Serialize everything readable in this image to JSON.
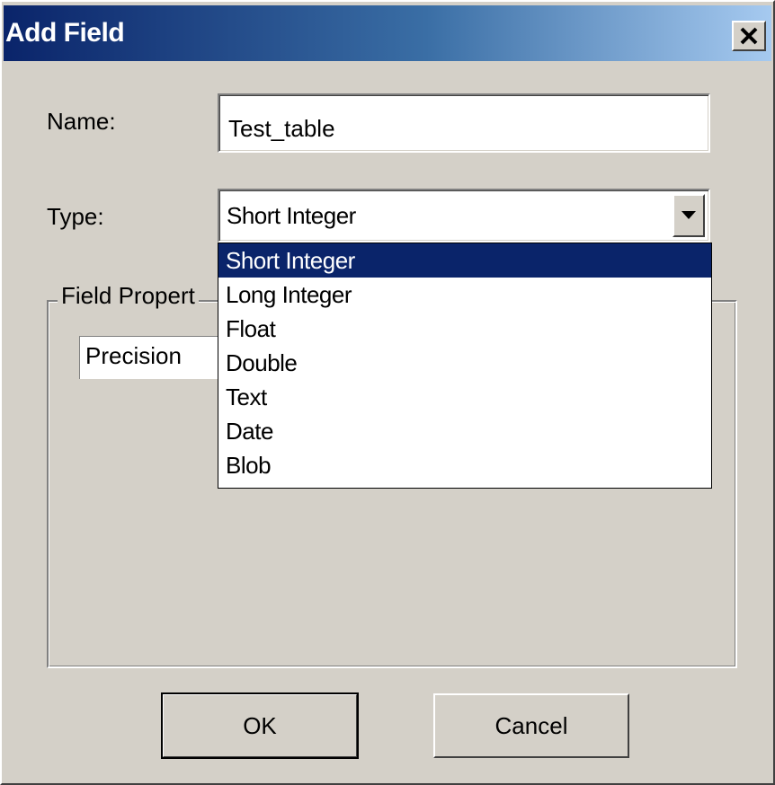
{
  "window": {
    "title": "Add Field",
    "close_icon": "close-icon"
  },
  "form": {
    "name_label": "Name:",
    "name_value": "Test_table",
    "type_label": "Type:",
    "type_value": "Short Integer"
  },
  "type_options": [
    "Short Integer",
    "Long Integer",
    "Float",
    "Double",
    "Text",
    "Date",
    "Blob"
  ],
  "selected_option": "Short Integer",
  "field_properties": {
    "legend": "Field Propert",
    "precision_label": "Precision"
  },
  "buttons": {
    "ok_label": "OK",
    "cancel_label": "Cancel"
  },
  "colors": {
    "face": "#d4d0c8",
    "titlebar_start": "#0a246a",
    "titlebar_end": "#a6caf0",
    "highlight": "#0a246a"
  }
}
